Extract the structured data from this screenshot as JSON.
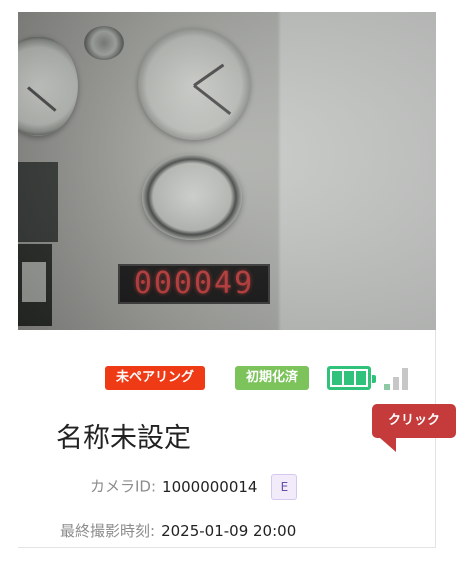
{
  "camera_card": {
    "preview": {
      "display_readout": "000049"
    },
    "badges": {
      "pairing_status": "未ペアリング",
      "init_status": "初期化済"
    },
    "battery_level": 1.0,
    "signal_bars": 1,
    "title": "名称未設定",
    "camera_id_label": "カメラID:",
    "camera_id_value": "1000000014",
    "camera_id_tag": "E",
    "last_capture_label": "最終撮影時刻:",
    "last_capture_value": "2025-01-09 20:00"
  },
  "tooltip": {
    "label": "クリック"
  },
  "colors": {
    "pairing_badge": "#ef3a16",
    "init_badge": "#7bc35a",
    "battery": "#30c27a",
    "tooltip": "#c53a3a"
  }
}
